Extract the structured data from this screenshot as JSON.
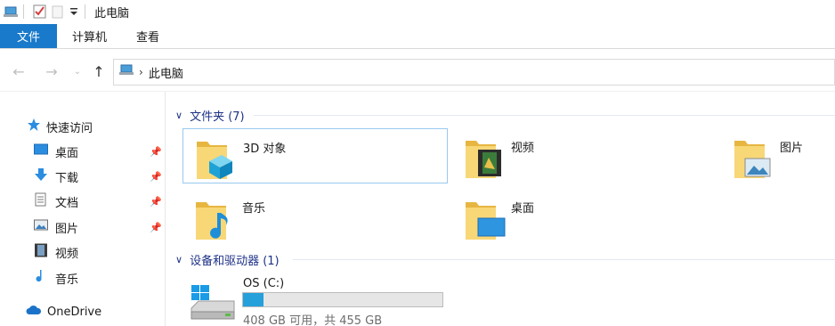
{
  "window": {
    "title": "此电脑"
  },
  "ribbon": {
    "tabs": [
      "文件",
      "计算机",
      "查看"
    ]
  },
  "address": {
    "path": [
      "此电脑"
    ]
  },
  "sidebar": {
    "quick_access": "快速访问",
    "items": [
      {
        "label": "桌面",
        "pinned": true
      },
      {
        "label": "下载",
        "pinned": true
      },
      {
        "label": "文档",
        "pinned": true
      },
      {
        "label": "图片",
        "pinned": true
      },
      {
        "label": "视频",
        "pinned": false
      },
      {
        "label": "音乐",
        "pinned": false
      }
    ],
    "onedrive": "OneDrive"
  },
  "main": {
    "folders_header": "文件夹 (7)",
    "folders": [
      "3D 对象",
      "视频",
      "图片",
      "音乐",
      "桌面"
    ],
    "devices_header": "设备和驱动器 (1)",
    "drive": {
      "name": "OS (C:)",
      "status": "408 GB 可用，共 455 GB",
      "used_fraction": 0.103
    }
  },
  "colors": {
    "accent": "#1979ca",
    "drive_fill": "#26a0da",
    "group_header": "#1e3287"
  }
}
